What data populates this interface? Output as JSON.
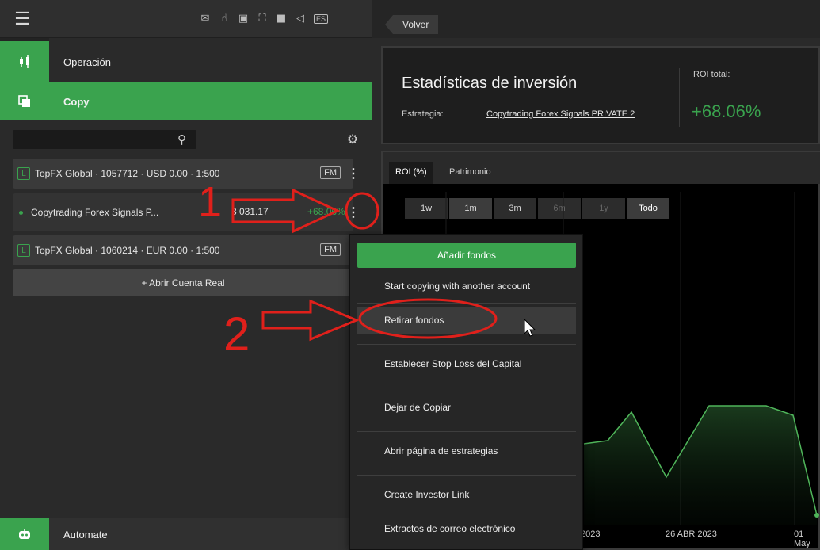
{
  "toolbar": {
    "lang_label": "ES"
  },
  "nav": {
    "operation_label": "Operación",
    "copy_label": "Copy",
    "automate_label": "Automate"
  },
  "accounts": [
    {
      "badge": "L",
      "label": "TopFX Global · 1057712 · USD 0.00 · 1:500",
      "tag": "FM"
    },
    {
      "label": "Copytrading Forex Signals P...",
      "balance": "3 031.17",
      "pct": "+68.06%"
    },
    {
      "badge": "L",
      "label": "TopFX Global · 1060214 · EUR 0.00 · 1:500",
      "tag": "FM"
    }
  ],
  "open_real_label": "+ Abrir Cuenta Real",
  "back_label": "Volver",
  "stats": {
    "title": "Estadísticas de inversión",
    "strategy_label": "Estrategia:",
    "strategy_value": "Copytrading Forex Signals PRIVATE 2",
    "roi_label": "ROI total:",
    "roi_value": "+68.06%"
  },
  "chart_tabs": [
    "ROI (%)",
    "Patrimonio"
  ],
  "ranges": [
    "1w",
    "1m",
    "3m",
    "6m",
    "1y",
    "Todo"
  ],
  "chart_data": {
    "type": "area",
    "x": [
      "2023",
      "26 ABR 2023",
      "01 May"
    ],
    "series": [
      {
        "values": []
      }
    ]
  },
  "menu": {
    "items": [
      "Añadir fondos",
      "Start copying with another account",
      "Retirar fondos",
      "Establecer Stop Loss del Capital",
      "Dejar de Copiar",
      "Abrir página de estrategias",
      "Create Investor Link",
      "Extractos de correo electrónico"
    ]
  },
  "annotations": {
    "step1": "1",
    "step2": "2"
  },
  "colors": {
    "accent": "#3aa34e",
    "annotation": "#e0201b"
  }
}
